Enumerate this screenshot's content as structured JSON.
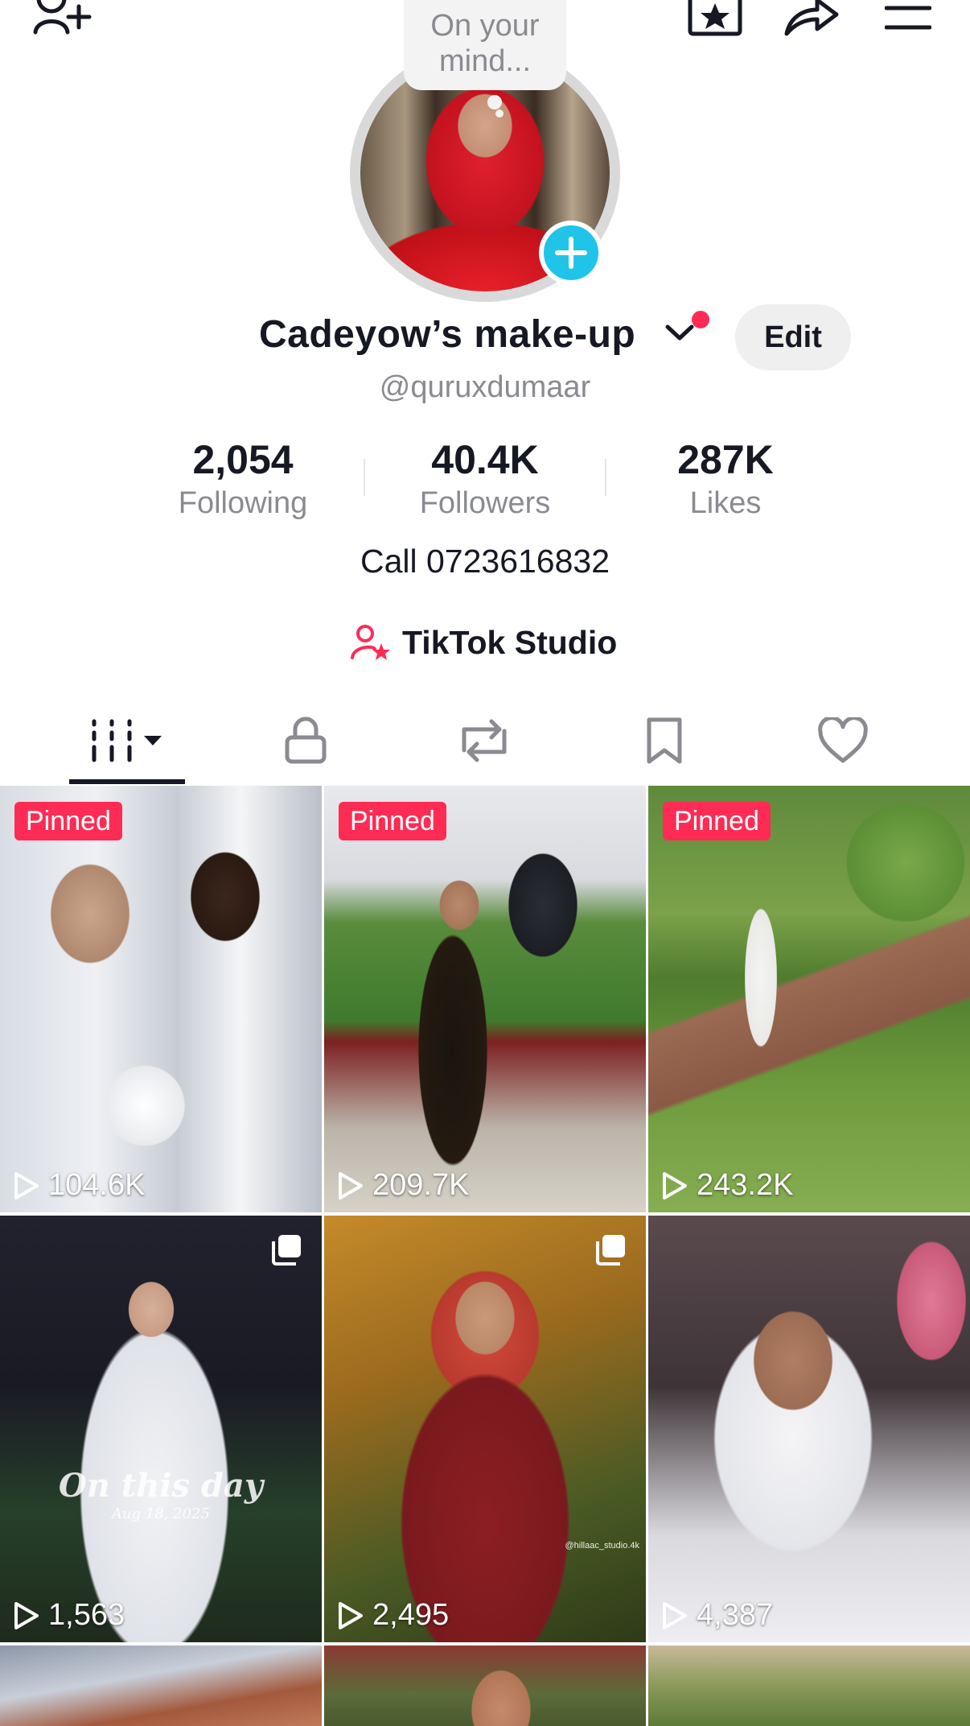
{
  "top_bar": {
    "icons": [
      "add-friend-icon",
      "favorites-icon",
      "share-icon",
      "menu-icon"
    ]
  },
  "avatar": {
    "bubble_text": "On your mind..."
  },
  "profile": {
    "display_name": "Cadeyow’s make-up",
    "username": "@quruxdumaar",
    "edit_label": "Edit",
    "bio": "Call 0723616832",
    "studio_label": "TikTok Studio"
  },
  "stats": [
    {
      "value": "2,054",
      "label": "Following"
    },
    {
      "value": "40.4K",
      "label": "Followers"
    },
    {
      "value": "287K",
      "label": "Likes"
    }
  ],
  "tabs": [
    "videos-grid-icon",
    "lock-icon",
    "repost-icon",
    "bookmark-icon",
    "heart-icon"
  ],
  "videos": [
    {
      "badge": "Pinned",
      "views": "104.6K"
    },
    {
      "badge": "Pinned",
      "views": "209.7K"
    },
    {
      "badge": "Pinned",
      "views": "243.2K"
    },
    {
      "views": "1,563",
      "caption": "On this day",
      "caption_date": "Aug 18, 2025"
    },
    {
      "views": "2,495",
      "watermark": "@hillaac_studio.4k"
    },
    {
      "views": "4,387"
    }
  ],
  "colors": {
    "accent": "#fe2c55",
    "add_button": "#20c4e8",
    "text_primary": "#161823",
    "text_secondary": "#8a8b91"
  }
}
